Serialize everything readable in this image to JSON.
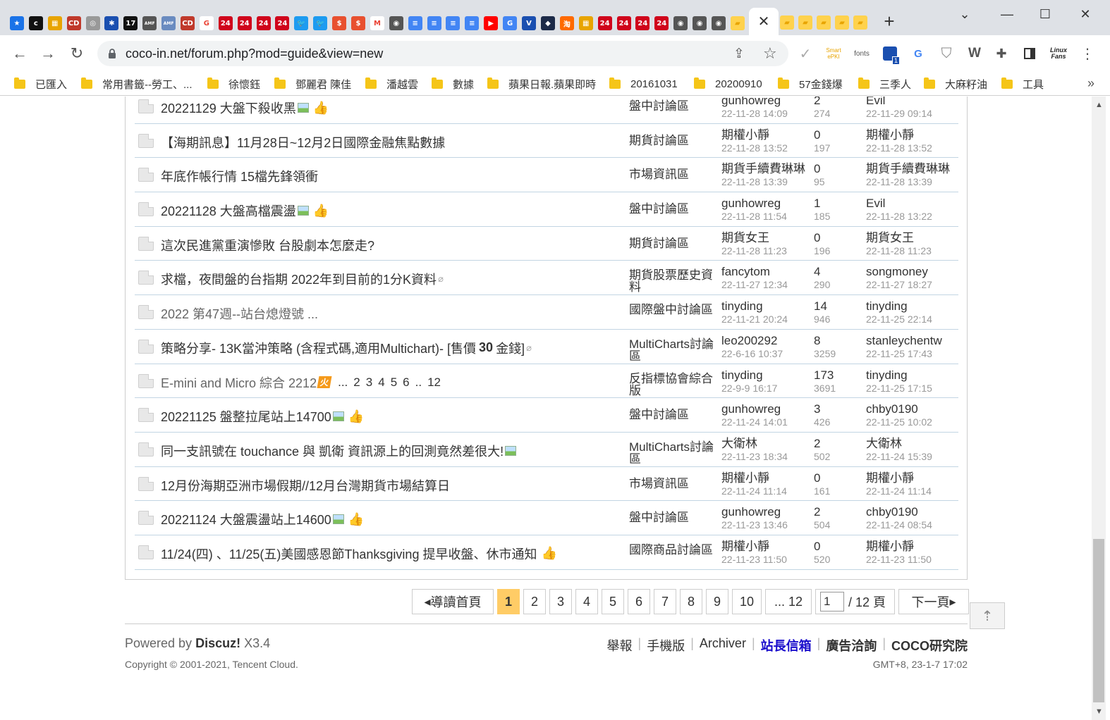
{
  "browser": {
    "tab_title": "",
    "url": "coco-in.net/forum.php?mod=guide&view=new",
    "tab_favicons": [
      {
        "name": "bookmark-star-icon",
        "color": "#1a73e8",
        "glyph": "★"
      },
      {
        "name": "red-logo-icon",
        "color": "#111111",
        "glyph": "c"
      },
      {
        "name": "grid-logo-icon",
        "color": "#e8a400",
        "glyph": "▦"
      },
      {
        "name": "cd-logo-icon",
        "color": "#c0392b",
        "glyph": "CD"
      },
      {
        "name": "circle-logo-icon",
        "color": "#999999",
        "glyph": "◎"
      },
      {
        "name": "asterisk-logo-icon",
        "color": "#1a4fb0",
        "glyph": "✱"
      },
      {
        "name": "17-logo-icon",
        "color": "#111111",
        "glyph": "17"
      },
      {
        "name": "amf-logo-icon",
        "color": "#555555",
        "glyph": "AMF"
      },
      {
        "name": "amf2-logo-icon",
        "color": "#6a8bc0",
        "glyph": "AMF"
      },
      {
        "name": "cd2-logo-icon",
        "color": "#c0392b",
        "glyph": "CD"
      },
      {
        "name": "google-icon",
        "color": "#ffffff",
        "glyph": "G"
      },
      {
        "name": "24-logo-icon",
        "color": "#d0021b",
        "glyph": "24"
      },
      {
        "name": "24-logo-icon",
        "color": "#d0021b",
        "glyph": "24"
      },
      {
        "name": "24-logo-icon",
        "color": "#d0021b",
        "glyph": "24"
      },
      {
        "name": "24-logo-icon",
        "color": "#d0021b",
        "glyph": "24"
      },
      {
        "name": "twitter-icon",
        "color": "#1d9bf0",
        "glyph": "🐦"
      },
      {
        "name": "twitter-icon",
        "color": "#1d9bf0",
        "glyph": "🐦"
      },
      {
        "name": "shopping-bag-icon",
        "color": "#e8502f",
        "glyph": "$"
      },
      {
        "name": "shopping-bag-icon",
        "color": "#e8502f",
        "glyph": "$"
      },
      {
        "name": "gmail-icon",
        "color": "#ffffff",
        "glyph": "M"
      },
      {
        "name": "globe-icon",
        "color": "#555555",
        "glyph": "◉"
      },
      {
        "name": "docs-icon",
        "color": "#4285f4",
        "glyph": "≡"
      },
      {
        "name": "docs-icon",
        "color": "#4285f4",
        "glyph": "≡"
      },
      {
        "name": "docs-icon",
        "color": "#4285f4",
        "glyph": "≡"
      },
      {
        "name": "docs-icon",
        "color": "#4285f4",
        "glyph": "≡"
      },
      {
        "name": "youtube-icon",
        "color": "#ff0000",
        "glyph": "▶"
      },
      {
        "name": "translate-icon",
        "color": "#4285f4",
        "glyph": "G"
      },
      {
        "name": "v-logo-icon",
        "color": "#1a4fb0",
        "glyph": "V"
      },
      {
        "name": "dark-logo-icon",
        "color": "#1c2a48",
        "glyph": "◆"
      },
      {
        "name": "taobao-icon",
        "color": "#ff6a00",
        "glyph": "淘"
      },
      {
        "name": "grid-logo-icon",
        "color": "#e8a400",
        "glyph": "▦"
      },
      {
        "name": "24-logo-icon",
        "color": "#d0021b",
        "glyph": "24"
      },
      {
        "name": "24-logo-icon",
        "color": "#d0021b",
        "glyph": "24"
      },
      {
        "name": "24-logo-icon",
        "color": "#d0021b",
        "glyph": "24"
      },
      {
        "name": "24-logo-icon",
        "color": "#d0021b",
        "glyph": "24"
      },
      {
        "name": "globe-icon",
        "color": "#555555",
        "glyph": "◉"
      },
      {
        "name": "globe-icon",
        "color": "#555555",
        "glyph": "◉"
      },
      {
        "name": "globe-icon",
        "color": "#555555",
        "glyph": "◉"
      },
      {
        "name": "coco-logo-icon",
        "color": "#f5b400",
        "glyph": "▰"
      }
    ],
    "tab_favicons_after": [
      {
        "name": "coco-logo-icon",
        "color": "#f5b400",
        "glyph": "▰"
      },
      {
        "name": "coco-logo-icon",
        "color": "#f5b400",
        "glyph": "▰"
      },
      {
        "name": "coco-logo-icon",
        "color": "#f5b400",
        "glyph": "▰"
      },
      {
        "name": "coco-logo-icon",
        "color": "#f5b400",
        "glyph": "▰"
      },
      {
        "name": "coco-logo-icon",
        "color": "#f5b400",
        "glyph": "▰"
      }
    ],
    "extensions": {
      "smart_label": "Smart ePKI",
      "fonts_label": "fonts",
      "badge_count": "1",
      "w_label": "W",
      "linux_label": "Linux Fans"
    },
    "bookmarks": [
      "已匯入",
      "常用書籤--勞工、...",
      "徐懷鈺",
      "鄧麗君 陳佳",
      "潘越雲",
      "數據",
      "蘋果日報.蘋果即時",
      "20161031",
      "20200910",
      "57金錢爆",
      "三季人",
      "大麻籽油",
      "工具"
    ]
  },
  "threads": [
    {
      "title": "20221129 大盤下殺收黑",
      "img": true,
      "thumb": true,
      "board": "盤中討論區",
      "author": "gunhowreg",
      "author_date": "22-11-28 14:09",
      "replies": "2",
      "views": "274",
      "last_user": "Evil",
      "last_date": "22-11-29 09:14"
    },
    {
      "title": "【海期訊息】11月28日~12月2日國際金融焦點數據",
      "board": "期貨討論區",
      "author": "期權小靜",
      "author_date": "22-11-28 13:52",
      "replies": "0",
      "views": "197",
      "last_user": "期權小靜",
      "last_date": "22-11-28 13:52"
    },
    {
      "title": "年底作帳行情 15檔先鋒領衝",
      "board": "市場資訊區",
      "author": "期貨手續費琳琳",
      "author_date": "22-11-28 13:39",
      "replies": "0",
      "views": "95",
      "last_user": "期貨手續費琳琳",
      "last_date": "22-11-28 13:39"
    },
    {
      "title": "20221128 大盤高檔震盪",
      "img": true,
      "thumb": true,
      "board": "盤中討論區",
      "author": "gunhowreg",
      "author_date": "22-11-28 11:54",
      "replies": "1",
      "views": "185",
      "last_user": "Evil",
      "last_date": "22-11-28 13:22"
    },
    {
      "title": "這次民進黨重演慘敗 台股劇本怎麼走?",
      "board": "期貨討論區",
      "author": "期貨女王",
      "author_date": "22-11-28 11:23",
      "replies": "0",
      "views": "196",
      "last_user": "期貨女王",
      "last_date": "22-11-28 11:23"
    },
    {
      "title": "求檔，夜間盤的台指期 2022年到目前的1分K資料",
      "clip": true,
      "board": "期貨股票歷史資料",
      "author": "fancytom",
      "author_date": "22-11-27 12:34",
      "replies": "4",
      "views": "290",
      "last_user": "songmoney",
      "last_date": "22-11-27 18:27"
    },
    {
      "title": "2022 第47週--站台熄燈號 ...",
      "visited": true,
      "board": "國際盤中討論區",
      "author": "tinyding",
      "author_date": "22-11-21 20:24",
      "replies": "14",
      "views": "946",
      "last_user": "tinyding",
      "last_date": "22-11-25 22:14"
    },
    {
      "title": "策略分享- 13K當沖策略 (含程式碼,適用Multichart)- [售價",
      "price": "30",
      "price_suffix": "金錢]",
      "clip": true,
      "board": "MultiCharts討論區",
      "author": "leo200292",
      "author_date": "22-6-16 10:37",
      "replies": "8",
      "views": "3259",
      "last_user": "stanleychentw",
      "last_date": "22-11-25 17:43"
    },
    {
      "title": "E-mini and Micro 綜合 2212",
      "visited": true,
      "hot": "火",
      "pages": [
        "...",
        "2",
        "3",
        "4",
        "5",
        "6",
        "..",
        "12"
      ],
      "board": "反指標協會綜合版",
      "author": "tinyding",
      "author_date": "22-9-9 16:17",
      "replies": "173",
      "views": "3691",
      "last_user": "tinyding",
      "last_date": "22-11-25 17:15"
    },
    {
      "title": "20221125 盤整拉尾站上14700",
      "img": true,
      "thumb": true,
      "board": "盤中討論區",
      "author": "gunhowreg",
      "author_date": "22-11-24 14:01",
      "replies": "3",
      "views": "426",
      "last_user": "chby0190",
      "last_date": "22-11-25 10:02"
    },
    {
      "title": "同一支訊號在 touchance 與 凱衛 資訊源上的回測竟然差很大!",
      "img": true,
      "board": "MultiCharts討論區",
      "author": "大衛林",
      "author_date": "22-11-23 18:34",
      "replies": "2",
      "views": "502",
      "last_user": "大衛林",
      "last_date": "22-11-24 15:39"
    },
    {
      "title": "12月份海期亞洲市場假期//12月台灣期貨市場結算日",
      "board": "市場資訊區",
      "author": "期權小靜",
      "author_date": "22-11-24 11:14",
      "replies": "0",
      "views": "161",
      "last_user": "期權小靜",
      "last_date": "22-11-24 11:14"
    },
    {
      "title": "20221124 大盤震盪站上14600",
      "img": true,
      "thumb": true,
      "board": "盤中討論區",
      "author": "gunhowreg",
      "author_date": "22-11-23 13:46",
      "replies": "2",
      "views": "504",
      "last_user": "chby0190",
      "last_date": "22-11-24 08:54"
    },
    {
      "title": "11/24(四) 、11/25(五)美國感恩節Thanksgiving 提早收盤、休市通知",
      "thumb": true,
      "board": "國際商品討論區",
      "author": "期權小靜",
      "author_date": "22-11-23 11:50",
      "replies": "0",
      "views": "520",
      "last_user": "期權小靜",
      "last_date": "22-11-23 11:50"
    }
  ],
  "pager": {
    "prev_label": "導讀首頁",
    "pages": [
      "1",
      "2",
      "3",
      "4",
      "5",
      "6",
      "7",
      "8",
      "9",
      "10",
      "... 12"
    ],
    "current": "1",
    "input_value": "1",
    "total_label": "/ 12 頁",
    "next_label": "下一頁"
  },
  "footer": {
    "powered_prefix": "Powered by",
    "powered_brand": "Discuz!",
    "powered_version": "X3.4",
    "copyright": "Copyright © 2001-2021, Tencent Cloud.",
    "links": [
      "舉報",
      "手機版",
      "Archiver",
      "站長信箱",
      "廣告洽詢",
      "COCO研究院"
    ],
    "time": "GMT+8, 23-1-7 17:02"
  }
}
